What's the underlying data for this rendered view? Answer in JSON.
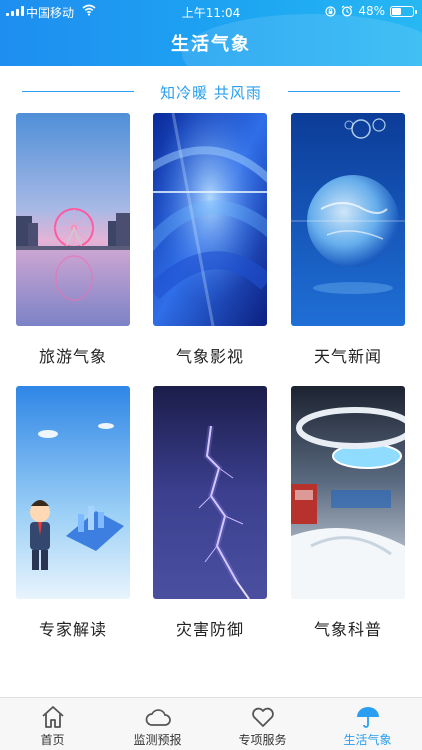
{
  "status_bar": {
    "carrier": "中国移动",
    "time": "上午11:04",
    "battery": "48%",
    "battery_level": 0.48
  },
  "header": {
    "title": "生活气象"
  },
  "slogan": "知冷暖  共风雨",
  "cards": [
    {
      "label": "旅游气象",
      "image": "ferris-wheel-lake"
    },
    {
      "label": "气象影视",
      "image": "blue-abstract"
    },
    {
      "label": "天气新闻",
      "image": "globe-bubbles"
    },
    {
      "label": "专家解读",
      "image": "expert-cartoon"
    },
    {
      "label": "灾害防御",
      "image": "lightning-storm"
    },
    {
      "label": "气象科普",
      "image": "exhibition-hall"
    }
  ],
  "tabbar": {
    "items": [
      {
        "label": "首页",
        "icon": "home-icon"
      },
      {
        "label": "监测预报",
        "icon": "cloud-icon"
      },
      {
        "label": "专项服务",
        "icon": "heart-icon"
      },
      {
        "label": "生活气象",
        "icon": "umbrella-icon",
        "active": true
      }
    ],
    "active_color": "#2a9ff0"
  }
}
